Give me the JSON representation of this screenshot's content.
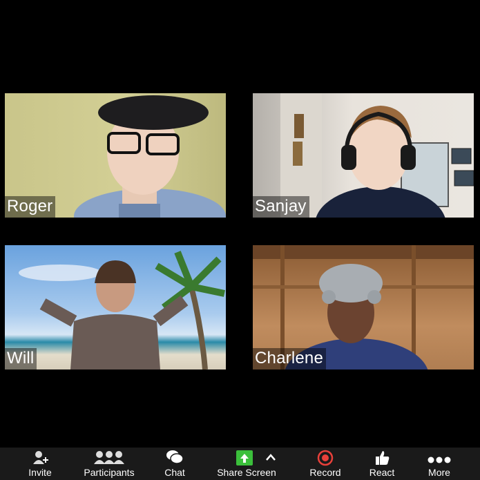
{
  "participants": [
    {
      "name": "Roger"
    },
    {
      "name": "Sanjay"
    },
    {
      "name": "Will"
    },
    {
      "name": "Charlene"
    }
  ],
  "toolbar": {
    "invite": {
      "label": "Invite",
      "icon": "invite-icon"
    },
    "participants": {
      "label": "Participants",
      "icon": "participants-icon"
    },
    "chat": {
      "label": "Chat",
      "icon": "chat-icon"
    },
    "share_screen": {
      "label": "Share Screen",
      "icon": "share-screen-icon",
      "color": "#3bbf3b"
    },
    "record": {
      "label": "Record",
      "icon": "record-icon",
      "color": "#e8403a"
    },
    "react": {
      "label": "React",
      "icon": "thumbs-up-icon"
    },
    "more": {
      "label": "More",
      "icon": "more-icon"
    }
  }
}
